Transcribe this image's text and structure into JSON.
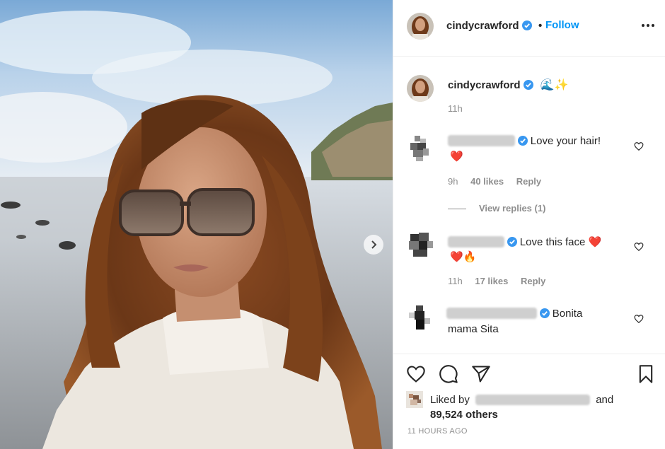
{
  "post": {
    "username": "cindycrawford",
    "follow_dot": "•",
    "follow_label": "Follow",
    "more_icon": "more-horizontal-icon",
    "verified_color": "#3897f0",
    "accent_color": "#0095f6"
  },
  "caption": {
    "username": "cindycrawford",
    "text": "🌊✨",
    "time": "11h"
  },
  "comments": [
    {
      "text": "Love your hair!",
      "emoji": "❤️",
      "time": "9h",
      "likes": "40 likes",
      "reply": "Reply",
      "view_replies": "View replies (1)"
    },
    {
      "text": "Love this face ❤️",
      "emoji": "❤️🔥",
      "time": "11h",
      "likes": "17 likes",
      "reply": "Reply"
    },
    {
      "text": "Bonita",
      "text2": "mama Sita"
    }
  ],
  "likes": {
    "prefix": "Liked by",
    "and": "and",
    "count": "89,524 others"
  },
  "timestamp": "11 HOURS AGO"
}
